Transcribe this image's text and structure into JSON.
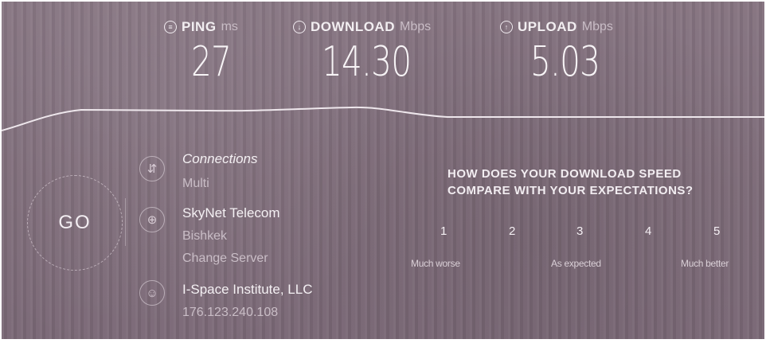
{
  "metrics": {
    "ping": {
      "label": "PING",
      "unit": "ms",
      "value": "27",
      "icon": "ping-icon"
    },
    "download": {
      "label": "DOWNLOAD",
      "unit": "Mbps",
      "value": "14.30",
      "icon": "download-arrow-icon"
    },
    "upload": {
      "label": "UPLOAD",
      "unit": "Mbps",
      "value": "5.03",
      "icon": "upload-arrow-icon"
    }
  },
  "go_button": {
    "label": "GO"
  },
  "connections": {
    "title": "Connections",
    "value": "Multi",
    "icon": "connections-icon"
  },
  "server": {
    "provider": "SkyNet Telecom",
    "city": "Bishkek",
    "change_label": "Change Server",
    "icon": "globe-icon"
  },
  "client": {
    "isp": "I-Space Institute, LLC",
    "ip": "176.123.240.108",
    "icon": "user-icon"
  },
  "survey": {
    "question_line1": "HOW DOES YOUR DOWNLOAD SPEED",
    "question_line2": "COMPARE WITH YOUR EXPECTATIONS?",
    "ratings": [
      "1",
      "2",
      "3",
      "4",
      "5"
    ],
    "captions": {
      "low": "Much worse",
      "mid": "As expected",
      "high": "Much better"
    }
  },
  "colors": {
    "panel_bg": "#7d6b78",
    "text": "#f4f0f3",
    "muted_text": "#c9bdc6"
  }
}
